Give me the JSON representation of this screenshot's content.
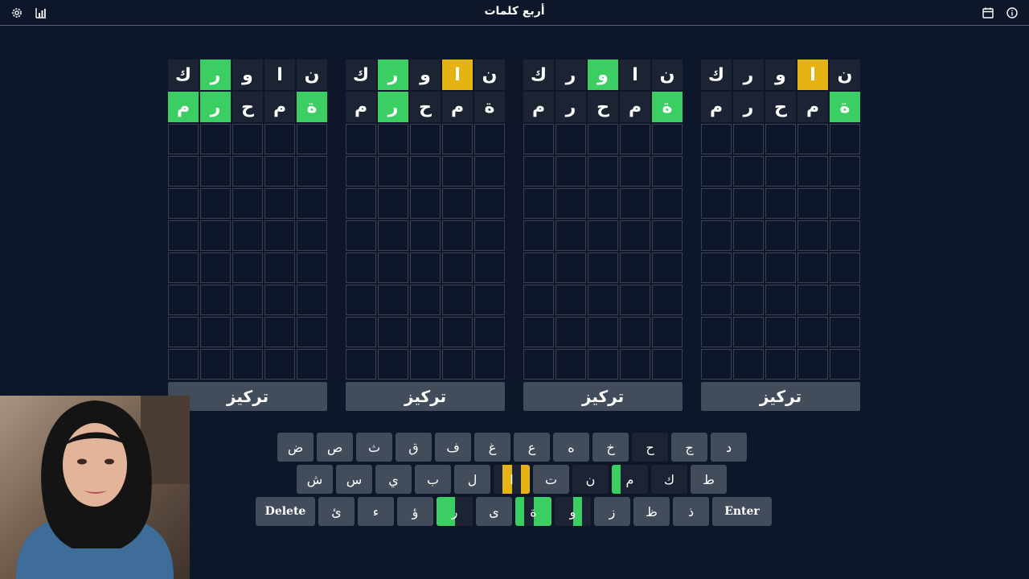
{
  "header": {
    "title": "أربع كلمات",
    "left_icons": [
      "settings-icon",
      "stats-icon"
    ],
    "right_icons": [
      "calendar-icon",
      "info-icon"
    ]
  },
  "boards": [
    {
      "rows": [
        [
          {
            "l": "ك",
            "s": "filled"
          },
          {
            "l": "ر",
            "s": "g"
          },
          {
            "l": "و",
            "s": "filled"
          },
          {
            "l": "ا",
            "s": "filled"
          },
          {
            "l": "ن",
            "s": "filled"
          }
        ],
        [
          {
            "l": "م",
            "s": "g"
          },
          {
            "l": "ر",
            "s": "g"
          },
          {
            "l": "ح",
            "s": "filled"
          },
          {
            "l": "م",
            "s": "filled"
          },
          {
            "l": "ة",
            "s": "g"
          }
        ]
      ],
      "focus_label": "تركيز"
    },
    {
      "rows": [
        [
          {
            "l": "ك",
            "s": "filled"
          },
          {
            "l": "ر",
            "s": "g"
          },
          {
            "l": "و",
            "s": "filled"
          },
          {
            "l": "ا",
            "s": "y"
          },
          {
            "l": "ن",
            "s": "filled"
          }
        ],
        [
          {
            "l": "م",
            "s": "filled"
          },
          {
            "l": "ر",
            "s": "g"
          },
          {
            "l": "ح",
            "s": "filled"
          },
          {
            "l": "م",
            "s": "filled"
          },
          {
            "l": "ة",
            "s": "filled"
          }
        ]
      ],
      "focus_label": "تركيز"
    },
    {
      "rows": [
        [
          {
            "l": "ك",
            "s": "filled"
          },
          {
            "l": "ر",
            "s": "filled"
          },
          {
            "l": "و",
            "s": "g"
          },
          {
            "l": "ا",
            "s": "filled"
          },
          {
            "l": "ن",
            "s": "filled"
          }
        ],
        [
          {
            "l": "م",
            "s": "filled"
          },
          {
            "l": "ر",
            "s": "filled"
          },
          {
            "l": "ح",
            "s": "filled"
          },
          {
            "l": "م",
            "s": "filled"
          },
          {
            "l": "ة",
            "s": "g"
          }
        ]
      ],
      "focus_label": "تركيز"
    },
    {
      "rows": [
        [
          {
            "l": "ك",
            "s": "filled"
          },
          {
            "l": "ر",
            "s": "filled"
          },
          {
            "l": "و",
            "s": "filled"
          },
          {
            "l": "ا",
            "s": "y"
          },
          {
            "l": "ن",
            "s": "filled"
          }
        ],
        [
          {
            "l": "م",
            "s": "filled"
          },
          {
            "l": "ر",
            "s": "filled"
          },
          {
            "l": "ح",
            "s": "filled"
          },
          {
            "l": "م",
            "s": "filled"
          },
          {
            "l": "ة",
            "s": "g"
          }
        ]
      ],
      "focus_label": "تركيز"
    }
  ],
  "total_rows": 10,
  "keyboard": {
    "rows": [
      [
        {
          "k": "ض"
        },
        {
          "k": "ص"
        },
        {
          "k": "ث"
        },
        {
          "k": "ق"
        },
        {
          "k": "ف"
        },
        {
          "k": "غ"
        },
        {
          "k": "ع"
        },
        {
          "k": "ه"
        },
        {
          "k": "خ"
        },
        {
          "k": "ح",
          "state": [
            "n",
            "n",
            "n",
            "n"
          ]
        },
        {
          "k": "ج"
        },
        {
          "k": "د"
        }
      ],
      [
        {
          "k": "ش"
        },
        {
          "k": "س"
        },
        {
          "k": "ي"
        },
        {
          "k": "ب"
        },
        {
          "k": "ل"
        },
        {
          "k": "ا",
          "state": [
            "n",
            "y",
            "n",
            "y"
          ]
        },
        {
          "k": "ت"
        },
        {
          "k": "ن",
          "state": [
            "n",
            "n",
            "n",
            "n"
          ]
        },
        {
          "k": "م",
          "state": [
            "g",
            "n",
            "n",
            "n"
          ]
        },
        {
          "k": "ك",
          "state": [
            "n",
            "n",
            "n",
            "n"
          ]
        },
        {
          "k": "ط"
        }
      ],
      [
        {
          "k": "Delete",
          "wide": true
        },
        {
          "k": "ئ"
        },
        {
          "k": "ء"
        },
        {
          "k": "ؤ"
        },
        {
          "k": "ر",
          "state": [
            "g",
            "g",
            "n",
            "n"
          ]
        },
        {
          "k": "ى"
        },
        {
          "k": "ة",
          "state": [
            "g",
            "n",
            "g",
            "g"
          ]
        },
        {
          "k": "و",
          "state": [
            "n",
            "n",
            "g",
            "n"
          ]
        },
        {
          "k": "ز"
        },
        {
          "k": "ظ"
        },
        {
          "k": "ذ"
        },
        {
          "k": "Enter",
          "wide": true
        }
      ]
    ]
  },
  "colors": {
    "background": "#0e1729",
    "correct": "#3bcf63",
    "present": "#e6b315",
    "absent": "#1c2434",
    "key": "#434c5b"
  }
}
